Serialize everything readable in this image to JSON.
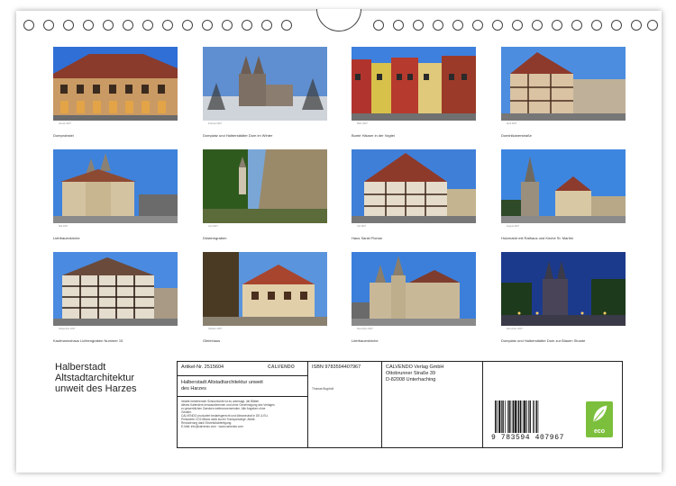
{
  "calendar": {
    "title_lines": [
      "Halberstadt",
      "Altstadtarchitektur",
      "unweit des Harzes"
    ],
    "months": [
      {
        "month": "Januar 2027",
        "caption": "Domprobstei"
      },
      {
        "month": "Februar 2027",
        "caption": "Domplatz und Halberstädter Dom im Winter"
      },
      {
        "month": "März 2027",
        "caption": "Bunte Häuser in der Vogtei"
      },
      {
        "month": "April 2027",
        "caption": "Dominikanerstraße"
      },
      {
        "month": "Mai 2027",
        "caption": "Liebfrauenkirche"
      },
      {
        "month": "Juni 2027",
        "caption": "Düsteregraben"
      },
      {
        "month": "Juli 2027",
        "caption": "Haus Sankt Florian"
      },
      {
        "month": "August 2027",
        "caption": "Holzmarkt mit Rathaus und Kirche St. Martini"
      },
      {
        "month": "September 2027",
        "caption": "Kaufmannshaus Lichtengraben Nummer 15"
      },
      {
        "month": "Oktober 2027",
        "caption": "Gleimhaus"
      },
      {
        "month": "November 2027",
        "caption": "Liebfrauenkirche"
      },
      {
        "month": "Dezember 2027",
        "caption": "Domplatz und Halberstädter Dom zur Blauen Stunde"
      }
    ]
  },
  "info": {
    "article_label": "Artikel-Nr. 2515604",
    "brand": "CALVENDO",
    "product_title_lines": [
      "Halberstadt Altstadtarchitektur unweit",
      "des Harzes"
    ],
    "legal_lines": [
      "Inhalte bestehender Schutzrechte ist es untersagt, die Blätter",
      "dieses Kalenders herauszutrennen und ohne Genehmigung des Verlages",
      "zu gewerblichen Zwecken weiterzuverwenden. Alle Angaben ohne",
      "Gewähr.",
      "CALVENDO produziert bedarfsgerecht und klimaneutral in DE & EU.",
      "Preiswerte CO2-Bilanz dank kurzer Transportwege. Abfall-",
      "Reduzierung dank Einzelstückfertigung.",
      "E-Mail: info@calvendo.com · www.calvendo.com"
    ],
    "isbn": "ISBN 9783594407967",
    "author": "Thomas Bugdroll",
    "publisher_lines": [
      "CALVENDO Verlag GmbH",
      "Ottobrunner Straße 39",
      "D-82008 Unterhaching"
    ],
    "barcode_number": "9 783594 407967",
    "eco_label": "eco"
  },
  "colors": {
    "sky": "#3f86e0",
    "night": "#1c3a8c",
    "eco_green": "#7cbf3c"
  }
}
